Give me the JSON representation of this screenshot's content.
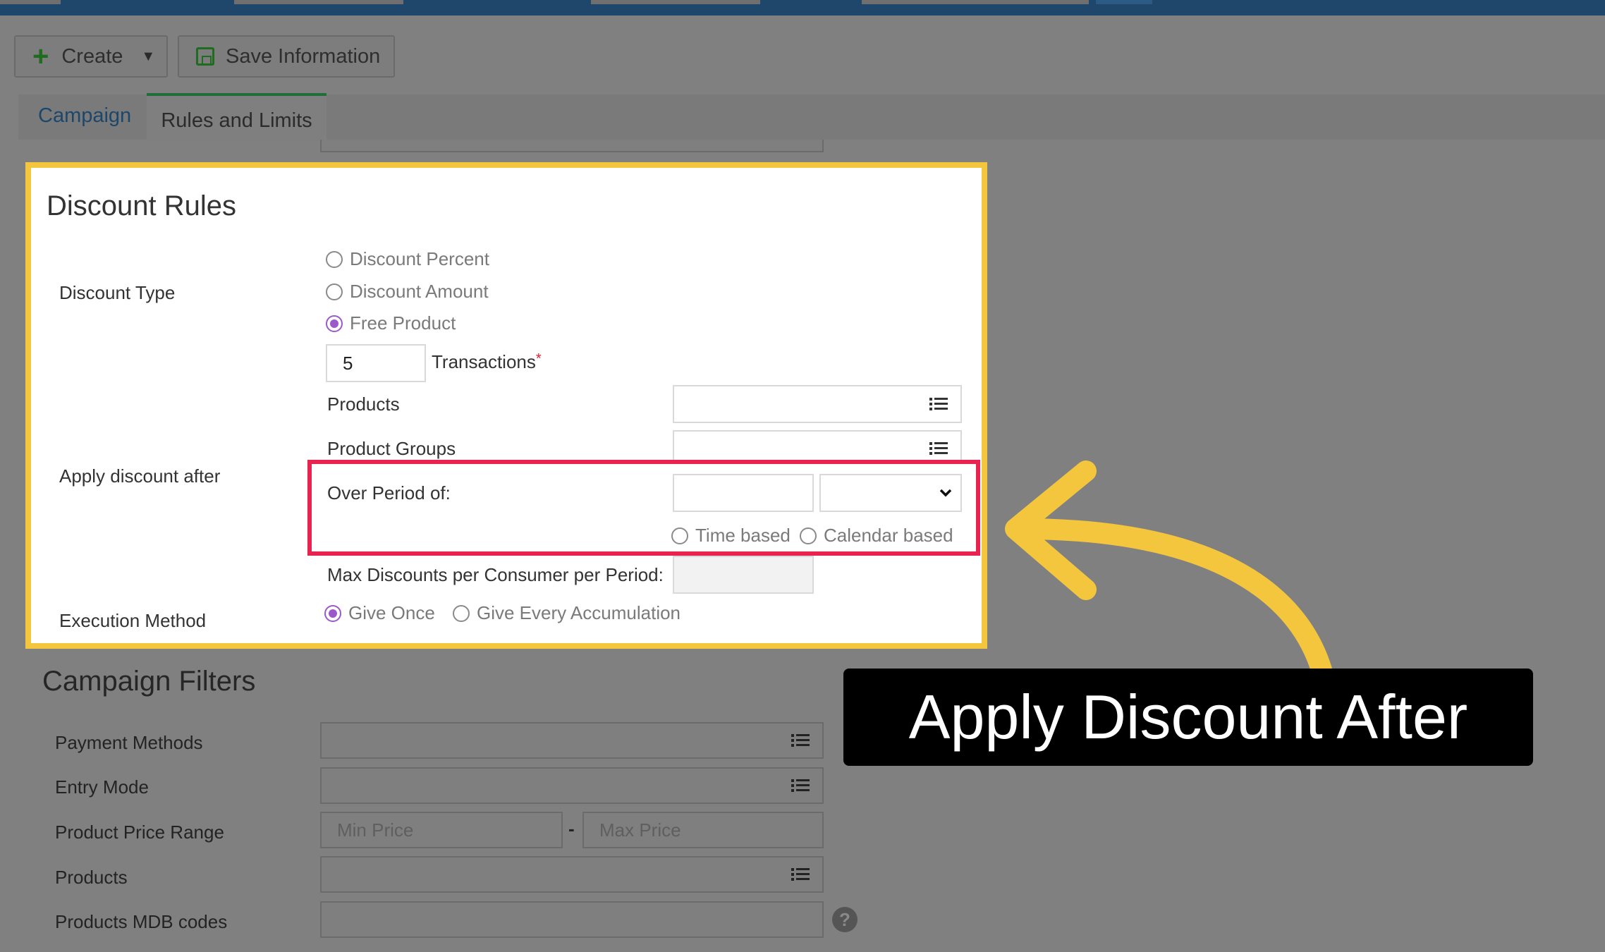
{
  "toolbar": {
    "create_label": "Create",
    "save_label": "Save Information"
  },
  "tabs": [
    {
      "label": "Campaign"
    },
    {
      "label": "Rules and Limits"
    }
  ],
  "discount_rules": {
    "title": "Discount Rules",
    "discount_type_label": "Discount Type",
    "discount_type_options": [
      "Discount Percent",
      "Discount Amount",
      "Free Product"
    ],
    "discount_type_selected": "Free Product",
    "apply_after_label": "Apply discount after",
    "transactions_value": "5",
    "transactions_label": "Transactions",
    "required_mark": "*",
    "products_label": "Products",
    "product_groups_label": "Product Groups",
    "over_period_label": "Over Period of:",
    "period_options": [
      "Time based",
      "Calendar based"
    ],
    "max_discounts_label": "Max Discounts per Consumer per Period:",
    "execution_method_label": "Execution Method",
    "execution_options": [
      "Give Once",
      "Give Every Accumulation"
    ],
    "execution_selected": "Give Once"
  },
  "campaign_filters": {
    "title": "Campaign Filters",
    "payment_methods_label": "Payment Methods",
    "entry_mode_label": "Entry Mode",
    "price_range_label": "Product Price Range",
    "min_price_placeholder": "Min Price",
    "range_separator": "-",
    "max_price_placeholder": "Max Price",
    "products_label": "Products",
    "mdb_codes_label": "Products MDB codes",
    "help_glyph": "?"
  },
  "annotation": {
    "callout_text": "Apply Discount After",
    "highlight_color": "#f4c63d",
    "focus_color": "#e8234f",
    "arrow_color": "#f4c63d"
  }
}
